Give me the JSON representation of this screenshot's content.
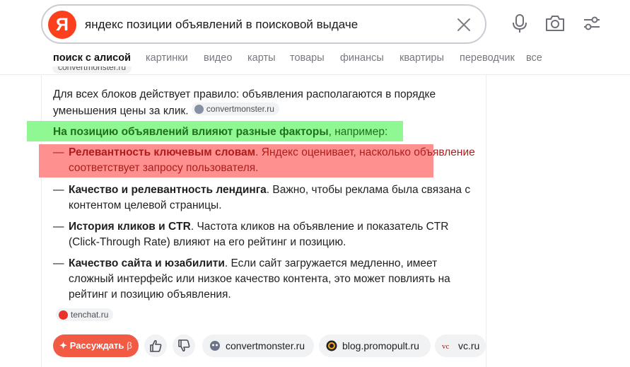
{
  "search": {
    "logo_letter": "Я",
    "query": "яндекс позиции объявлений в поисковой выдаче"
  },
  "toolbar": {
    "clear_icon": "close-icon",
    "voice_icon": "microphone-icon",
    "camera_icon": "camera-icon",
    "settings_icon": "filters-icon"
  },
  "tabs": [
    {
      "label": "поиск с алисой",
      "active": true
    },
    {
      "label": "картинки"
    },
    {
      "label": "видео"
    },
    {
      "label": "карты"
    },
    {
      "label": "товары"
    },
    {
      "label": "финансы"
    },
    {
      "label": "квартиры"
    },
    {
      "label": "переводчик"
    },
    {
      "label": "все"
    }
  ],
  "answer": {
    "top_chip": "convertmonster.ru",
    "intro": "Для всех блоков действует правило: объявления располагаются в порядке уменьшения цены за клик.",
    "intro_source": "convertmonster.ru",
    "lead_bold": "На позицию объявлений влияют разные факторы",
    "lead_rest": ", например:",
    "dash": "—",
    "items": [
      {
        "bold": "Релевантность ключевым словам",
        "text": ". Яндекс оценивает, насколько объявление соответствует запросу пользователя."
      },
      {
        "bold": "Качество и релевантность лендинга",
        "text": ". Важно, чтобы реклама была связана с контентом целевой страницы."
      },
      {
        "bold": "История кликов и CTR",
        "text": ". Частота кликов на объявление и показатель CTR (Click-Through Rate) влияют на его рейтинг и позицию."
      },
      {
        "bold": "Качество сайта и юзабилити",
        "text": ". Если сайт загружается медленно, имеет сложный интерфейс или низкое качество контента, это может повлиять на рейтинг и позицию объявления."
      }
    ],
    "footer_source": "tenchat.ru"
  },
  "actions": {
    "ask_label": "Рассуждать",
    "ask_beta": "β",
    "sources": [
      "convertmonster.ru",
      "blog.promopult.ru",
      "vc.ru"
    ]
  },
  "colors": {
    "brand": "#fc3f1d",
    "highlight_green": "#7df77f",
    "highlight_red": "#ff8a8a"
  }
}
